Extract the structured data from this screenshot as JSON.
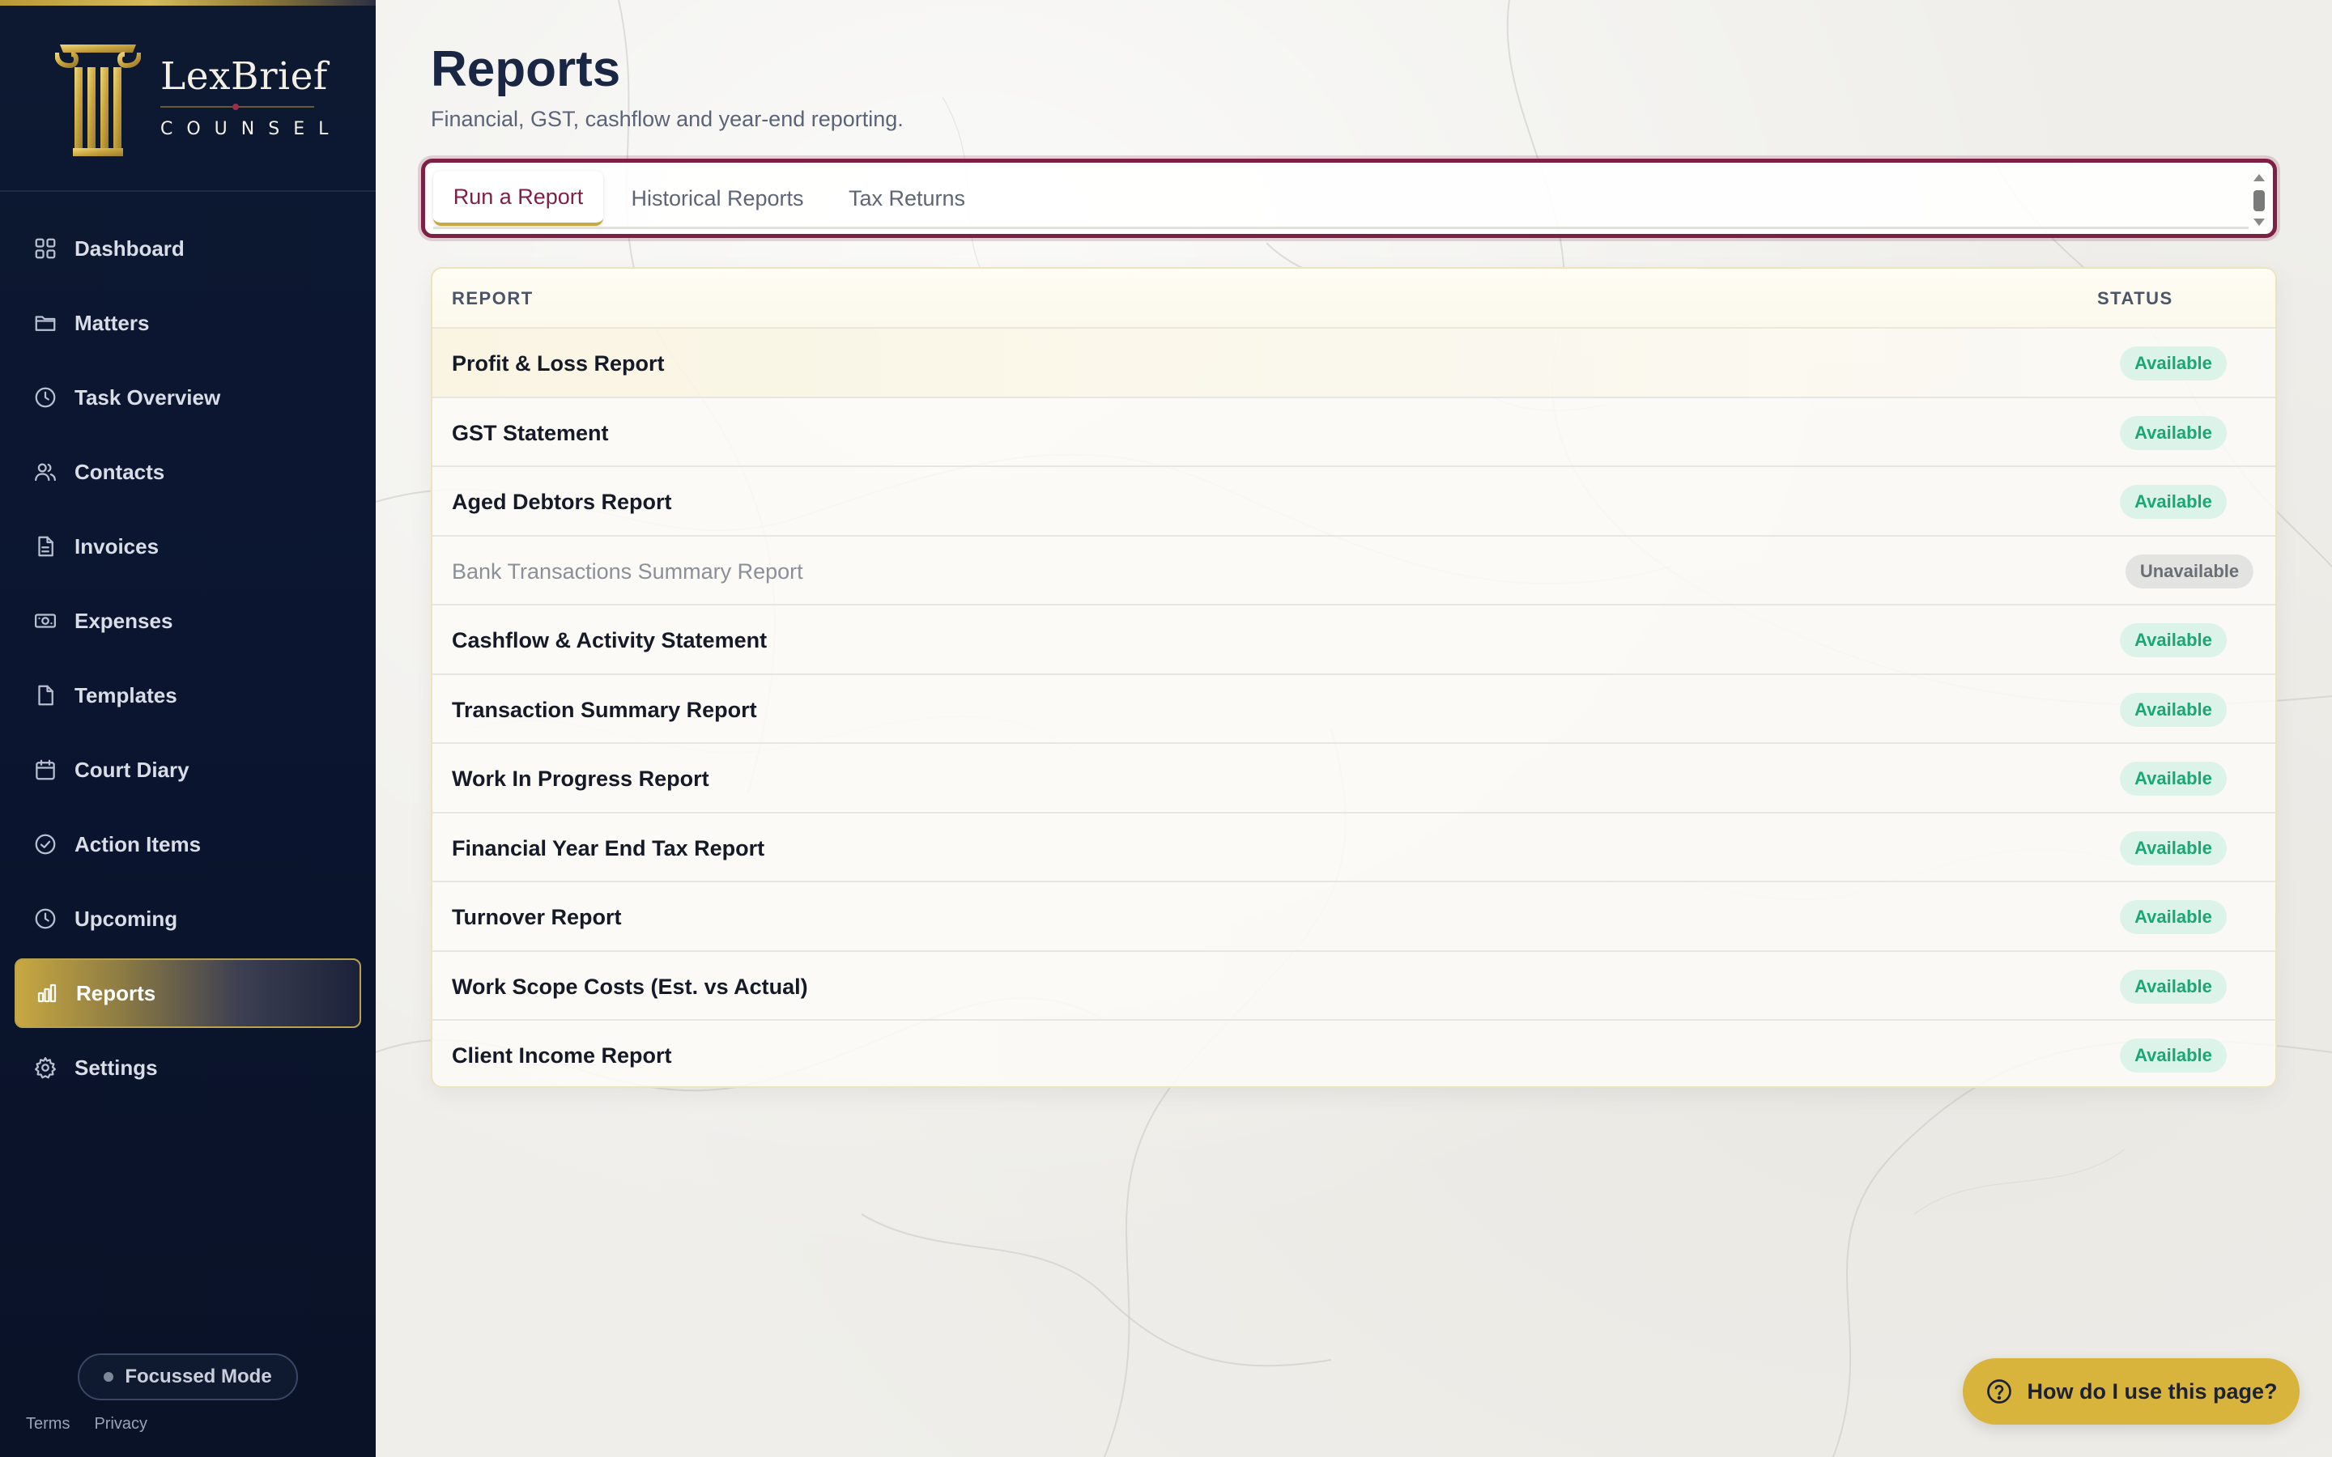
{
  "brand": {
    "name": "LexBrief",
    "sub": "COUNSEL"
  },
  "sidebar": {
    "items": [
      {
        "label": "Dashboard",
        "icon": "grid-icon"
      },
      {
        "label": "Matters",
        "icon": "folder-icon"
      },
      {
        "label": "Task Overview",
        "icon": "clock-icon"
      },
      {
        "label": "Contacts",
        "icon": "users-icon"
      },
      {
        "label": "Invoices",
        "icon": "invoice-icon"
      },
      {
        "label": "Expenses",
        "icon": "banknote-icon"
      },
      {
        "label": "Templates",
        "icon": "file-icon"
      },
      {
        "label": "Court Diary",
        "icon": "calendar-icon"
      },
      {
        "label": "Action Items",
        "icon": "check-circle-icon"
      },
      {
        "label": "Upcoming",
        "icon": "clock-icon"
      },
      {
        "label": "Reports",
        "icon": "bar-chart-icon",
        "active": true
      },
      {
        "label": "Settings",
        "icon": "gear-icon"
      }
    ],
    "focus_mode": "Focussed Mode",
    "footer": {
      "terms": "Terms",
      "privacy": "Privacy"
    }
  },
  "page": {
    "title": "Reports",
    "subtitle": "Financial, GST, cashflow and year-end reporting."
  },
  "tabs": [
    {
      "label": "Run a Report",
      "active": true
    },
    {
      "label": "Historical Reports"
    },
    {
      "label": "Tax Returns"
    }
  ],
  "table": {
    "columns": {
      "report": "REPORT",
      "status": "STATUS"
    },
    "rows": [
      {
        "name": "Profit & Loss Report",
        "status": "Available"
      },
      {
        "name": "GST Statement",
        "status": "Available"
      },
      {
        "name": "Aged Debtors Report",
        "status": "Available"
      },
      {
        "name": "Bank Transactions Summary Report",
        "status": "Unavailable"
      },
      {
        "name": "Cashflow & Activity Statement",
        "status": "Available"
      },
      {
        "name": "Transaction Summary Report",
        "status": "Available"
      },
      {
        "name": "Work In Progress Report",
        "status": "Available"
      },
      {
        "name": "Financial Year End Tax Report",
        "status": "Available"
      },
      {
        "name": "Turnover Report",
        "status": "Available"
      },
      {
        "name": "Work Scope Costs (Est. vs Actual)",
        "status": "Available"
      },
      {
        "name": "Client Income Report",
        "status": "Available"
      }
    ]
  },
  "help": {
    "label": "How do I use this page?"
  },
  "colors": {
    "sidebar_bg": "#0d1831",
    "accent_gold": "#c8a842",
    "accent_burgundy": "#7e1f45",
    "available_text": "#1aa776",
    "available_bg": "#dbf3e8",
    "unavailable_bg": "#e3e3e1"
  }
}
